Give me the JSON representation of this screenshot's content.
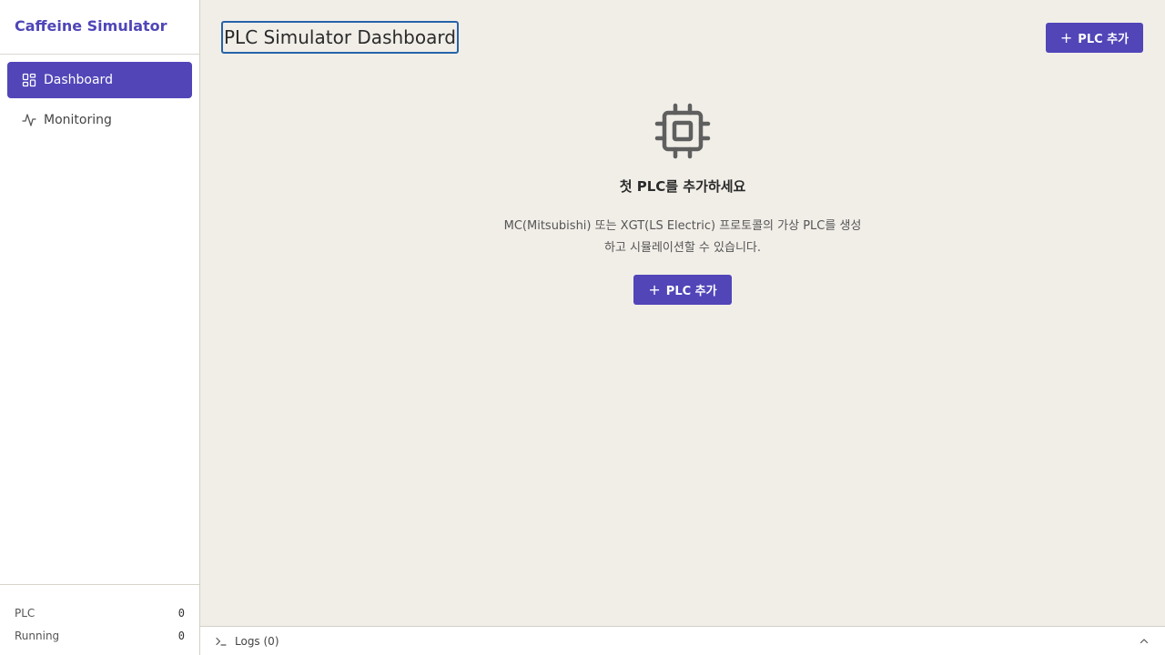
{
  "app": {
    "brand": "Caffeine Simulator",
    "accent_color": "#5145b8"
  },
  "sidebar": {
    "items": [
      {
        "label": "Dashboard",
        "icon": "dashboard-grid-icon",
        "active": true
      },
      {
        "label": "Monitoring",
        "icon": "activity-pulse-icon",
        "active": false
      }
    ],
    "stats": [
      {
        "label": "PLC",
        "value": "0"
      },
      {
        "label": "Running",
        "value": "0"
      }
    ]
  },
  "header": {
    "title": "PLC Simulator Dashboard",
    "add_label": "PLC 추가"
  },
  "empty_state": {
    "icon": "cpu-chip-icon",
    "title": "첫 PLC를 추가하세요",
    "description": "MC(Mitsubishi) 또는 XGT(LS Electric) 프로토콜의 가상 PLC를 생성하고 시뮬레이션할 수 있습니다.",
    "add_label": "PLC 추가"
  },
  "logs": {
    "label": "Logs (0)",
    "icon": "terminal-icon",
    "toggle_icon": "chevron-up-icon"
  }
}
